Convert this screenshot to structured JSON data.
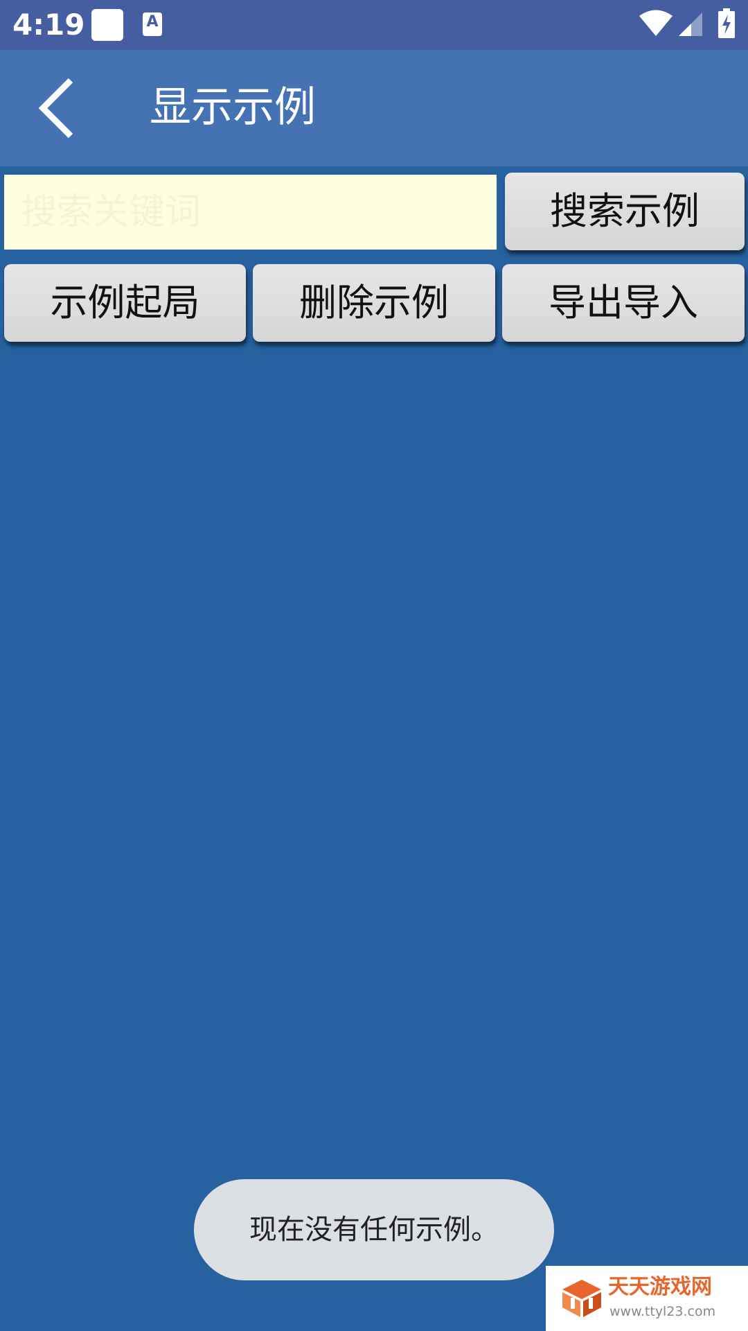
{
  "status_bar": {
    "time": "4:19",
    "icons": [
      "notification-square-icon",
      "keyboard-a-icon",
      "wifi-icon",
      "cell-signal-icon",
      "battery-charging-icon"
    ],
    "a_glyph": "A"
  },
  "app_bar": {
    "back_icon": "chevron-left-icon",
    "title": "显示示例"
  },
  "search": {
    "value": "",
    "placeholder": "搜索关键词",
    "button_label": "搜索示例"
  },
  "actions": {
    "start_label": "示例起局",
    "delete_label": "删除示例",
    "export_label": "导出导入"
  },
  "toast": {
    "message": "现在没有任何示例。"
  },
  "watermark": {
    "title": "天天游戏网",
    "url": "www.ttyl23.com"
  },
  "colors": {
    "background": "#2761a0",
    "status_bar": "#455ea1",
    "app_bar": "#4472b3",
    "search_field": "#fefee0",
    "button": "#dcdcdc",
    "toast": "#dcdfe3",
    "watermark_orange": "#e8662e"
  }
}
